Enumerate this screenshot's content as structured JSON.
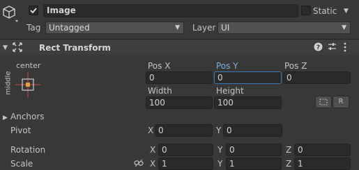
{
  "header": {
    "enabled": true,
    "name": "Image",
    "static_label": "Static",
    "tag_label": "Tag",
    "tag_value": "Untagged",
    "layer_label": "Layer",
    "layer_value": "UI"
  },
  "component": {
    "title": "Rect Transform"
  },
  "anchor_preset": {
    "horizontal": "center",
    "vertical": "middle"
  },
  "fields": {
    "pos_x_label": "Pos X",
    "pos_x": "0",
    "pos_y_label": "Pos Y",
    "pos_y": "0",
    "pos_z_label": "Pos Z",
    "pos_z": "0",
    "width_label": "Width",
    "width": "100",
    "height_label": "Height",
    "height": "100",
    "raw_edit_label": "R"
  },
  "anchors": {
    "label": "Anchors"
  },
  "pivot": {
    "label": "Pivot",
    "x_label": "X",
    "x": "0",
    "y_label": "Y",
    "y": "0"
  },
  "rotation": {
    "label": "Rotation",
    "x_label": "X",
    "x": "0",
    "y_label": "Y",
    "y": "0",
    "z_label": "Z",
    "z": "0"
  },
  "scale": {
    "label": "Scale",
    "x_label": "X",
    "x": "1",
    "y_label": "Y",
    "y": "1",
    "z_label": "Z",
    "z": "1"
  },
  "colors": {
    "background": "#383838",
    "field_bg": "#2a2a2a",
    "focus_accent": "#3a79bb",
    "active_label": "#7fb0e6",
    "anchor_red": "#d04a4a",
    "anchor_orange": "#e0a23a"
  }
}
